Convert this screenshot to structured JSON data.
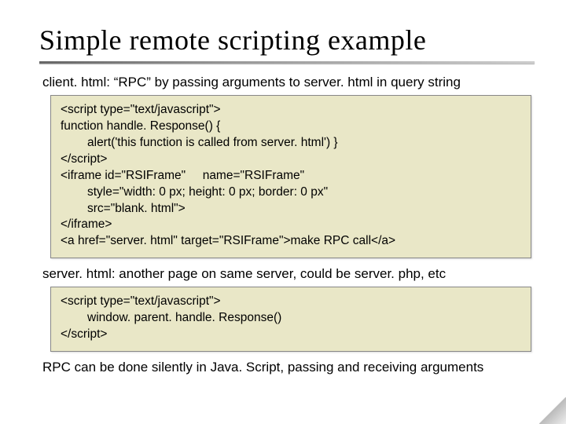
{
  "title": "Simple remote scripting example",
  "section1": {
    "heading": "client. html: “RPC” by passing arguments to server. html in query string",
    "code": {
      "l1": "<script type=\"text/javascript\">",
      "l2": "function handle. Response() {",
      "l3": "alert('this function is called from server. html') }",
      "l4": "</script>",
      "l5": "<iframe id=\"RSIFrame\"     name=\"RSIFrame\"",
      "l6": "style=\"width: 0 px; height: 0 px; border: 0 px\"",
      "l7": "src=\"blank. html\">",
      "l8": "</iframe>",
      "l9": "<a href=\"server. html\" target=\"RSIFrame\">make RPC call</a>"
    }
  },
  "section2": {
    "heading": "server. html: another page on same server, could be server. php, etc",
    "code": {
      "l1": "<script type=\"text/javascript\">",
      "l2": "window. parent. handle. Response()",
      "l3": "</script>"
    }
  },
  "footer": "RPC can be done silently in Java. Script, passing and receiving arguments"
}
